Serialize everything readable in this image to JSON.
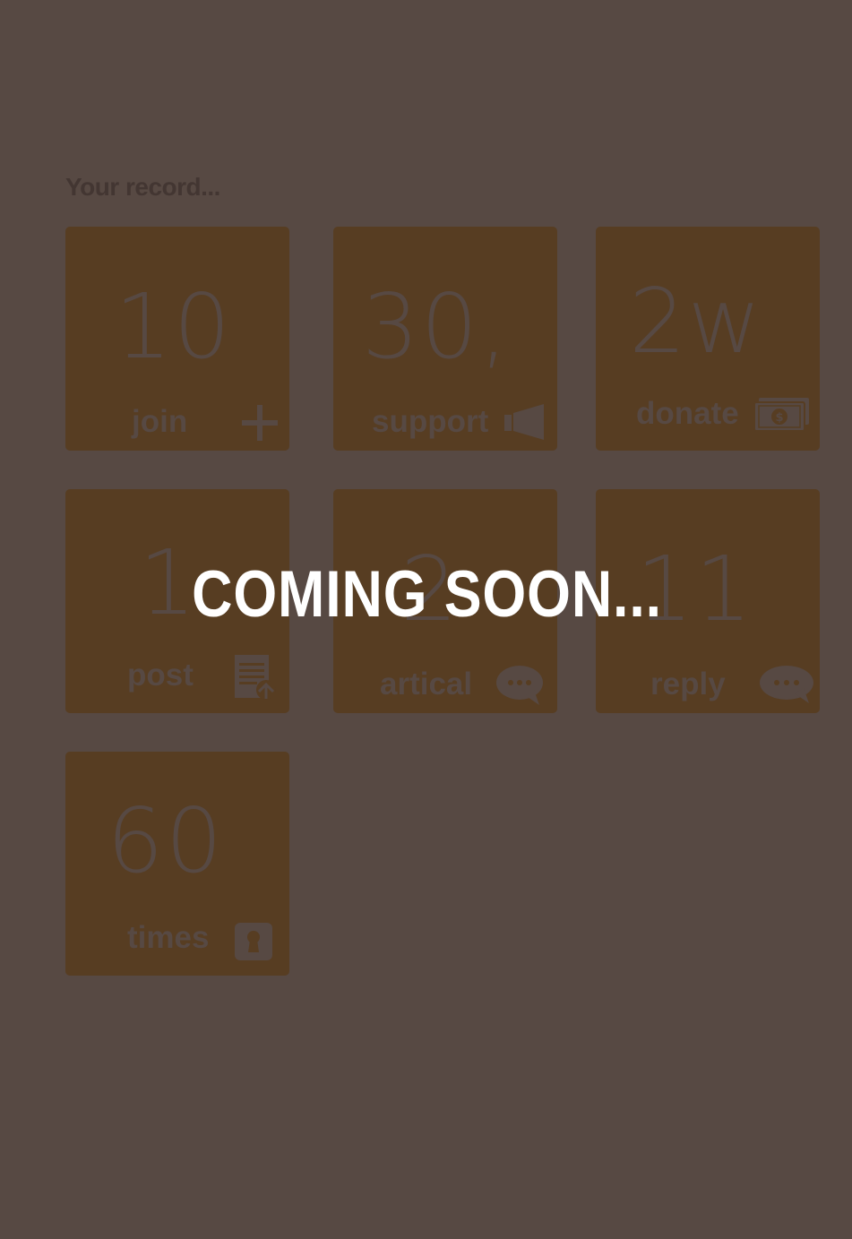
{
  "page": {
    "heading": "Your record...",
    "overlay": "COMING SOON..."
  },
  "tiles": [
    {
      "value": "10",
      "label": "join",
      "icon": "plus-icon"
    },
    {
      "value": "30,",
      "label": "support",
      "icon": "megaphone-icon"
    },
    {
      "value": "2w",
      "label": "donate",
      "icon": "money-icon"
    },
    {
      "value": "1",
      "label": "post",
      "icon": "document-upload-icon"
    },
    {
      "value": "2",
      "label": "artical",
      "icon": "chat-bubble-icon"
    },
    {
      "value": "11",
      "label": "reply",
      "icon": "chat-bubble-icon"
    },
    {
      "value": "60",
      "label": "times",
      "icon": "keyhole-icon"
    }
  ],
  "colors": {
    "background": "#574943",
    "tile": "#573d22",
    "overlay_text": "#ffffff"
  }
}
